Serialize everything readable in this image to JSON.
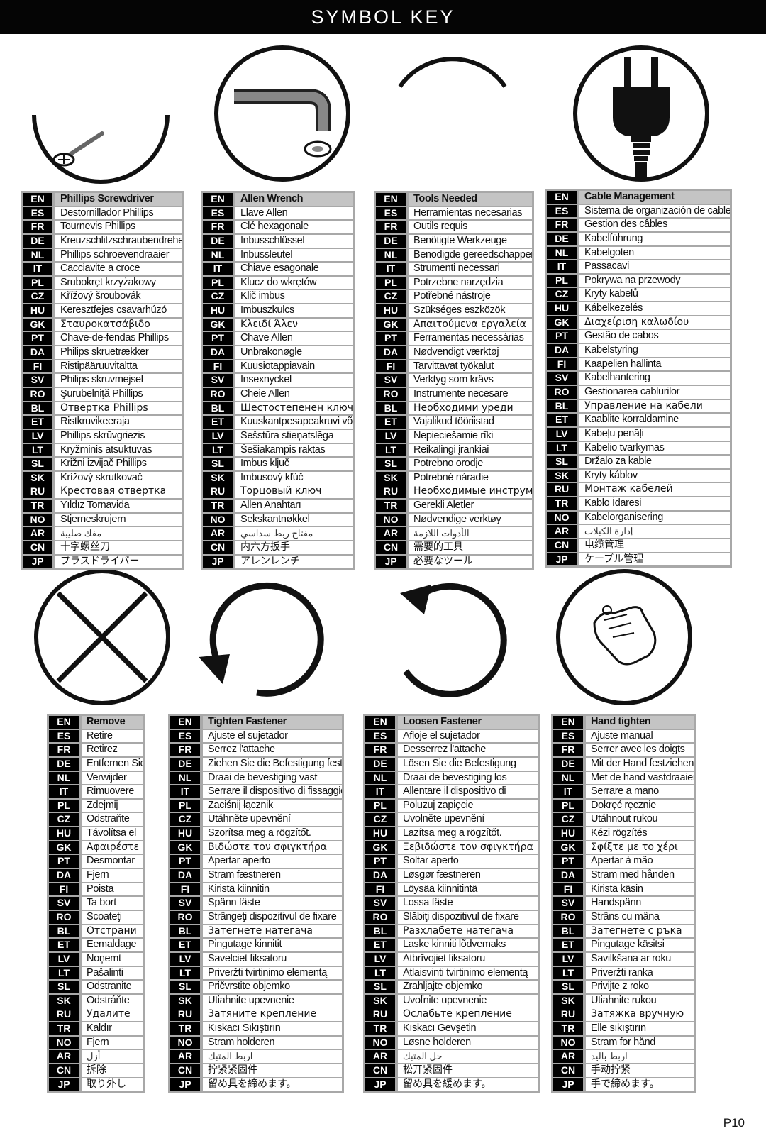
{
  "header": {
    "title": "SYMBOL KEY"
  },
  "footer": {
    "page_number": "P10"
  },
  "symbols": [
    {
      "id": "phillips-screwdriver",
      "icon": "screwdriver-icon"
    },
    {
      "id": "allen-wrench",
      "icon": "allen-wrench-icon"
    },
    {
      "id": "tools-needed",
      "icon": "tools-needed-icon"
    },
    {
      "id": "cable-management",
      "icon": "power-plug-icon"
    },
    {
      "id": "remove",
      "icon": "remove-x-icon"
    },
    {
      "id": "tighten-fastener",
      "icon": "clockwise-arrow-icon"
    },
    {
      "id": "loosen-fastener",
      "icon": "counterclockwise-arrow-icon"
    },
    {
      "id": "hand-tighten",
      "icon": "hand-icon"
    }
  ],
  "languages": [
    "EN",
    "ES",
    "FR",
    "DE",
    "NL",
    "IT",
    "PL",
    "CZ",
    "HU",
    "GK",
    "PT",
    "DA",
    "FI",
    "SV",
    "RO",
    "BL",
    "ET",
    "LV",
    "LT",
    "SL",
    "SK",
    "RU",
    "TR",
    "NO",
    "AR",
    "CN",
    "JP"
  ],
  "tables": [
    {
      "name": "phillips-screwdriver",
      "terms": [
        "Phillips Screwdriver",
        "Destornillador Phillips",
        "Tournevis Phillips",
        "Kreuzschlitzschraubendreher",
        "Phillips schroevendraaier",
        "Cacciavite a croce",
        "Śrubokręt krzyżakowy",
        "Křížový šroubovák",
        "Keresztfejes csavarhúzó",
        "Σταυροκατσάβιδο",
        "Chave-de-fendas Phillips",
        "Philips skruetrækker",
        "Ristipääruuvitaltta",
        "Philips skruvmejsel",
        "Şurubelniţă Phillips",
        "Отвертка Phillips",
        "Ristkruvikeeraja",
        "Phillips skrūvgriezis",
        "Kryžminis atsuktuvas",
        "Križni izvijač Phillips",
        "Krížový skrutkovač",
        "Крестовая отвертка",
        "Yıldız Tornavida",
        "Stjerneskrujern",
        "مفك صليبة",
        "十字螺丝刀",
        "プラスドライバー"
      ]
    },
    {
      "name": "allen-wrench",
      "terms": [
        "Allen Wrench",
        "Llave Allen",
        "Clé hexagonale",
        "Inbusschlüssel",
        "Inbussleutel",
        "Chiave esagonale",
        "Klucz do wkrętów",
        "Klič imbus",
        "Imbuszkulcs",
        "Κλειδί Άλεν",
        "Chave Allen",
        "Unbrakonøgle",
        "Kuusiotappiavain",
        "Insexnyckel",
        "Cheie Allen",
        "Шестостепенен ключ",
        "Kuuskantpesapeakruvi võti",
        "Sešstūra stieņatslēga",
        "Šešiakampis raktas",
        "Imbus ključ",
        "Imbusový kľúč",
        "Торцовый ключ",
        "Allen Anahtarı",
        "Sekskantnøkkel",
        "مفتاح ربط سداسي",
        "内六方扳手",
        "アレンレンチ"
      ]
    },
    {
      "name": "tools-needed",
      "terms": [
        "Tools Needed",
        "Herramientas necesarias",
        "Outils requis",
        "Benötigte Werkzeuge",
        "Benodigde gereedschappen",
        "Strumenti necessari",
        "Potrzebne narzędzia",
        "Potřebné nástroje",
        "Szükséges eszközök",
        "Απαιτούμενα εργαλεία",
        "Ferramentas necessárias",
        "Nødvendigt værktøj",
        "Tarvittavat työkalut",
        "Verktyg som krävs",
        "Instrumente necesare",
        "Необходими уреди",
        "Vajalikud tööriistad",
        "Nepieciešamie rīki",
        "Reikalingi įrankiai",
        "Potrebno orodje",
        "Potrebné náradie",
        "Необходимые инструменты",
        "Gerekli Aletler",
        "Nødvendige verktøy",
        "الأدوات اللازمة",
        "需要的工具",
        "必要なツール"
      ]
    },
    {
      "name": "cable-management",
      "terms": [
        "Cable Management",
        "Sistema de organización de cables",
        "Gestion des câbles",
        "Kabelführung",
        "Kabelgoten",
        "Passacavi",
        "Pokrywa na przewody",
        "Kryty kabelů",
        "Kábelkezelés",
        "Διαχείριση καλωδίου",
        "Gestão de cabos",
        "Kabelstyring",
        "Kaapelien hallinta",
        "Kabelhantering",
        "Gestionarea cablurilor",
        "Управление на кабели",
        "Kaablite korraldamine",
        "Kabeļu penāļi",
        "Kabelio tvarkymas",
        "Držalo za kable",
        "Kryty káblov",
        "Монтаж кабелей",
        "Kablo İdaresi",
        "Kabelorganisering",
        "إدارة الكبلات",
        "电缆管理",
        "ケーブル管理"
      ]
    },
    {
      "name": "remove",
      "terms": [
        "Remove",
        "Retire",
        "Retirez",
        "Entfernen Sie",
        "Verwijder",
        "Rimuovere",
        "Zdejmij",
        "Odstraňte",
        "Távolítsa el",
        "Αφαιρέστε",
        "Desmontar",
        "Fjern",
        "Poista",
        "Ta bort",
        "Scoateţi",
        "Отстрани",
        "Eemaldage",
        "Noņemt",
        "Pašalinti",
        "Odstranite",
        "Odstráňte",
        "Удалите",
        "Kaldır",
        "Fjern",
        "أزل",
        "拆除",
        "取り外し"
      ]
    },
    {
      "name": "tighten-fastener",
      "terms": [
        "Tighten Fastener",
        "Ajuste el sujetador",
        "Serrez l'attache",
        "Ziehen Sie die Befestigung fest",
        "Draai de bevestiging vast",
        "Serrare il dispositivo di fissaggio",
        "Zaciśnij łącznik",
        "Utáhněte upevnění",
        "Szorítsa meg a rögzítőt.",
        "Βιδώστε τον σφιγκτήρα",
        "Apertar aperto",
        "Stram fæstneren",
        "Kiristä kiinnitin",
        "Spänn fäste",
        "Strângeţi dispozitivul de fixare",
        "Затегнете натегача",
        "Pingutage kinnitit",
        "Savelciet fiksatoru",
        "Priveržti tvirtinimo elementą",
        "Pričvrstite objemko",
        "Utiahnite upevnenie",
        "Затяните крепление",
        "Kıskacı Sıkıştırın",
        "Stram holderen",
        "اربط المثبك",
        "拧紧紧固件",
        "留め具を締めます。"
      ]
    },
    {
      "name": "loosen-fastener",
      "terms": [
        "Loosen Fastener",
        "Afloje el sujetador",
        "Desserrez l'attache",
        "Lösen Sie die Befestigung",
        "Draai de bevestiging los",
        "Allentare il dispositivo di",
        "Poluzuj zapięcie",
        "Uvolněte upevnění",
        "Lazítsa meg a rögzítőt.",
        "Ξεβιδώστε τον σφιγκτήρα",
        "Soltar aperto",
        "Løsgør fæstneren",
        "Löysää kiinnitintä",
        "Lossa fäste",
        "Slăbiţi dispozitivul de fixare",
        "Разхлабете натегача",
        "Laske kinniti lõdvemaks",
        "Atbrīvojiet fiksatoru",
        "Atlaisvinti tvirtinimo elementą",
        "Zrahljajte objemko",
        "Uvoľnite upevnenie",
        "Ослабьте крепление",
        "Kıskacı Gevşetin",
        "Løsne holderen",
        "حل المثبك",
        "松开紧固件",
        "留め具を緩めます。"
      ]
    },
    {
      "name": "hand-tighten",
      "terms": [
        "Hand tighten",
        "Ajuste manual",
        "Serrer avec les doigts",
        "Mit der Hand festziehen",
        "Met de hand vastdraaien",
        "Serrare a mano",
        "Dokręć ręcznie",
        "Utáhnout rukou",
        "Kézi rögzítés",
        "Σφίξτε με το χέρι",
        "Apertar à mão",
        "Stram med hånden",
        "Kiristä käsin",
        "Handspänn",
        "Strâns cu mâna",
        "Затегнете с ръка",
        "Pingutage käsitsi",
        "Savilkšana ar roku",
        "Priveržti ranka",
        "Privijte z roko",
        "Utiahnite rukou",
        "Затяжка вручную",
        "Elle sıkıştırın",
        "Stram for hånd",
        "اربط باليد",
        "手动拧紧",
        "手で締めます。"
      ]
    }
  ]
}
